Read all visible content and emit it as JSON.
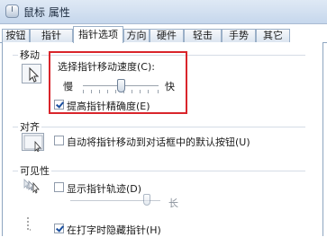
{
  "window": {
    "title": "鼠标 属性"
  },
  "tabs": [
    "按钮",
    "指针",
    "指针选项",
    "方向",
    "硬件",
    "轻击",
    "手势",
    "其它"
  ],
  "active_tab": "指针选项",
  "motion": {
    "group_label": "移动",
    "speed_label": "选择指针移动速度(C):",
    "slow_label": "慢",
    "fast_label": "快",
    "speed_level_fraction": 0.5,
    "precision_label": "提高指针精确度(E)",
    "precision_checked": true
  },
  "snap": {
    "group_label": "对齐",
    "label": "自动将指针移动到对话框中的默认按钮(U)",
    "checked": false
  },
  "visibility": {
    "group_label": "可见性",
    "trails_label": "显示指针轨迹(D)",
    "trails_checked": false,
    "trails_long_label": "长",
    "trails_level_fraction": 0.85,
    "hide_label": "在打字时隐藏指针(H)",
    "hide_checked": true
  },
  "colors": {
    "highlight": "#d9252b",
    "tab_border": "#8ea5c0",
    "titlebar": "#c6d7ec"
  }
}
